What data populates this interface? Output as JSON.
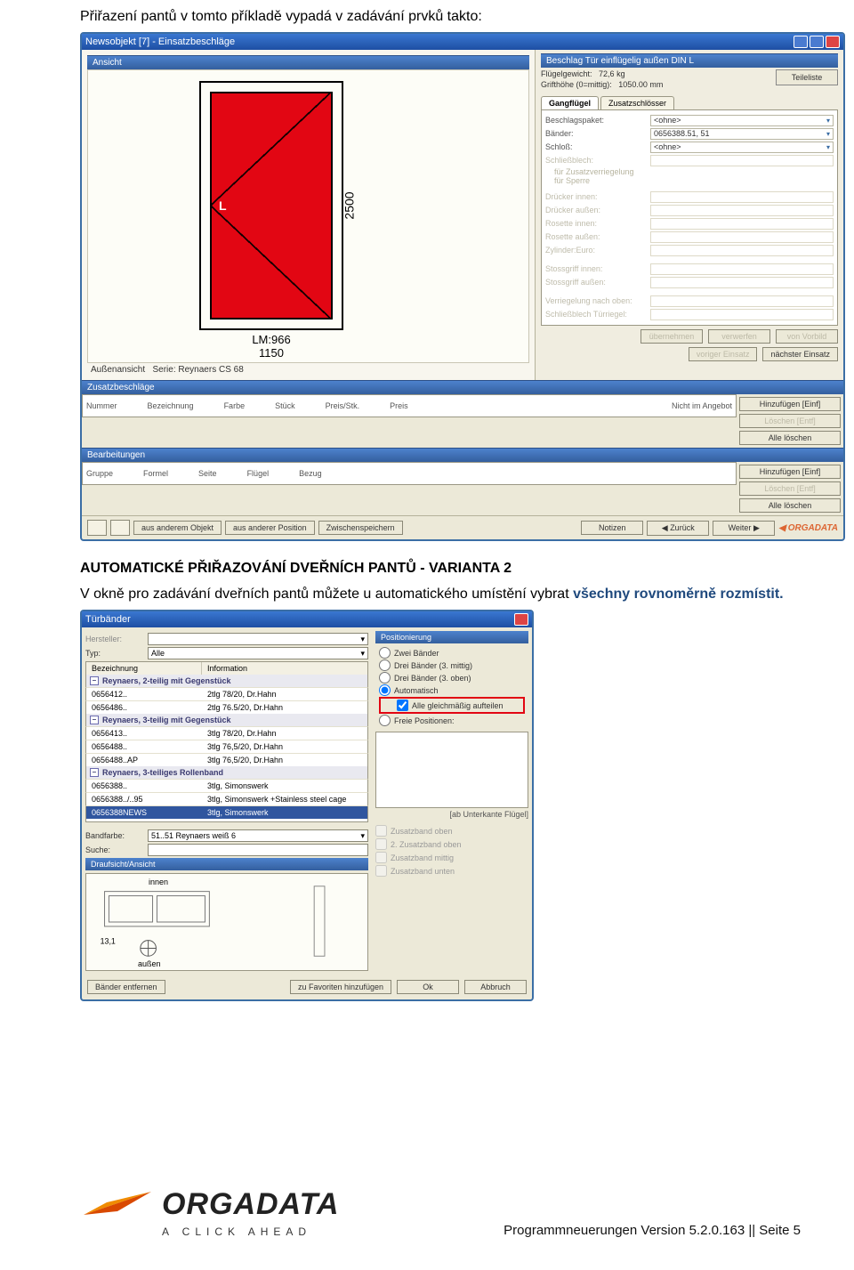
{
  "doc": {
    "intro_line": "Přiřazení pantů v tomto příkladě vypadá v zadávání prvků takto:",
    "heading": "AUTOMATICKÉ PŘIŘAZOVÁNÍ DVEŘNÍCH PANTŮ -  VARIANTA 2",
    "para_plain": "V okně pro zadávání dveřních pantů můžete u automatického umístění vybrat ",
    "para_em": "všechny rovnoměrně rozmístit.",
    "footer_text": "Programmneuerungen Version 5.2.0.163 || Seite 5",
    "logo_main": "ORGADATA",
    "logo_sub": "A CLICK AHEAD"
  },
  "w1": {
    "title": "Newsobjekt [7] - Einsatzbeschläge",
    "head_left": "Ansicht",
    "head_right": "Beschlag Tür einflügelig außen DIN L",
    "door_letter": "L",
    "dim_h": "2500",
    "dim_w1": "LM:966",
    "dim_w2": "1150",
    "sub1": "Außenansicht",
    "sub2": "Serie: Reynaers CS 68",
    "fl_k": "Flügelgewicht:",
    "fl_v": "72,6 kg",
    "gr_k": "Grifthöhe (0=mittig):",
    "gr_v": "1050.00",
    "gr_u": "mm",
    "btn_teileliste": "Teileliste",
    "tab1": "Gangflügel",
    "tab2": "Zusatzschlösser",
    "p_beschlag_k": "Beschlagspaket:",
    "p_beschlag_v": "<ohne>",
    "p_baender_k": "Bänder:",
    "p_baender_v": "0656388.51, 51",
    "p_schloss_k": "Schloß:",
    "p_schloss_v": "<ohne>",
    "p_schliess": "Schließblech:",
    "p_zusver": "für Zusatzverriegelung",
    "p_sperre": "für Sperre",
    "p_dinnen": "Drücker innen:",
    "p_daussen": "Drücker außen:",
    "p_rosinnen": "Rosette innen:",
    "p_rosaussen": "Rosette außen:",
    "p_zylinder": "Zylinder:Euro:",
    "p_stos_in": "Stossgriff innen:",
    "p_stos_out": "Stossgriff außen:",
    "p_vero": "Verriegelung nach oben:",
    "p_schlt": "Schließblech Türriegel:",
    "bt_ueber": "übernehmen",
    "bt_verw": "verwerfen",
    "bt_vonv": "von Vorbild",
    "bt_vorig": "voriger Einsatz",
    "bt_naech": "nächster Einsatz",
    "sec_zusatz": "Zusatzbeschläge",
    "g1_c1": "Nummer",
    "g1_c2": "Bezeichnung",
    "g1_c3": "Farbe",
    "g1_c4": "Stück",
    "g1_c5": "Preis/Stk.",
    "g1_c6": "Preis",
    "g1_c7": "Nicht im Angebot",
    "bt_hinz": "Hinzufügen [Einf]",
    "bt_loesch": "Löschen [Entf]",
    "bt_alle": "Alle löschen",
    "sec_bearb": "Bearbeitungen",
    "g2_c1": "Gruppe",
    "g2_c2": "Formel",
    "g2_c3": "Seite",
    "g2_c4": "Flügel",
    "g2_c5": "Bezug",
    "bb_ausobj": "aus anderem Objekt",
    "bb_auspos": "aus anderer Position",
    "bb_zwisch": "Zwischenspeichern",
    "bb_notiz": "Notizen",
    "bb_zurueck": "Zurück",
    "bb_weiter": "Weiter",
    "bb_brand": "ORGADATA"
  },
  "d1": {
    "title": "Türbänder",
    "lab_herst": "Hersteller:",
    "lab_typ": "Typ:",
    "typ_val": "Alle",
    "col_bez": "Bezeichnung",
    "col_info": "Information",
    "grp1": "Reynaers, 2-teilig mit Gegenstück",
    "r1a": "0656412..",
    "r1b": "2tlg 78/20, Dr.Hahn",
    "r2a": "0656486..",
    "r2b": "2tlg 76.5/20, Dr.Hahn",
    "grp2": "Reynaers, 3-teilig mit Gegenstück",
    "r3a": "0656413..",
    "r3b": "3tlg 78/20, Dr.Hahn",
    "r4a": "0656488..",
    "r4b": "3tlg 76,5/20, Dr.Hahn",
    "r5a": "0656488..AP",
    "r5b": "3tlg 76,5/20, Dr.Hahn",
    "grp3": "Reynaers, 3-teiliges Rollenband",
    "r6a": "0656388..",
    "r6b": "3tlg, Simonswerk",
    "r7a": "0656388../..95",
    "r7b": "3tlg, Simonswerk +Stainless steel cage",
    "r8a": "0656388NEWS",
    "r8b": "3tlg, Simonswerk",
    "lab_bandf": "Bandfarbe:",
    "bandf_val": "51..51 Reynaers weiß 6",
    "lab_suche": "Suche:",
    "sec_drauf": "Draufsicht/Ansicht",
    "innen": "innen",
    "aussen": "außen",
    "bt_entf": "Bänder entfernen",
    "bt_fav": "zu Favoriten hinzufügen",
    "bt_ok": "Ok",
    "bt_abbr": "Abbruch",
    "pos_title": "Positionierung",
    "opt_zwei": "Zwei Bänder",
    "opt_drei_m": "Drei Bänder (3. mittig)",
    "opt_drei_o": "Drei Bänder (3. oben)",
    "opt_auto": "Automatisch",
    "opt_gleich": "Alle gleichmäßig aufteilen",
    "opt_freie": "Freie Positionen:",
    "pos_hint": "[ab Unterkante Flügel]",
    "chk1": "Zusatzband oben",
    "chk2": "2. Zusatzband oben",
    "chk3": "Zusatzband mittig",
    "chk4": "Zusatzband unten"
  }
}
